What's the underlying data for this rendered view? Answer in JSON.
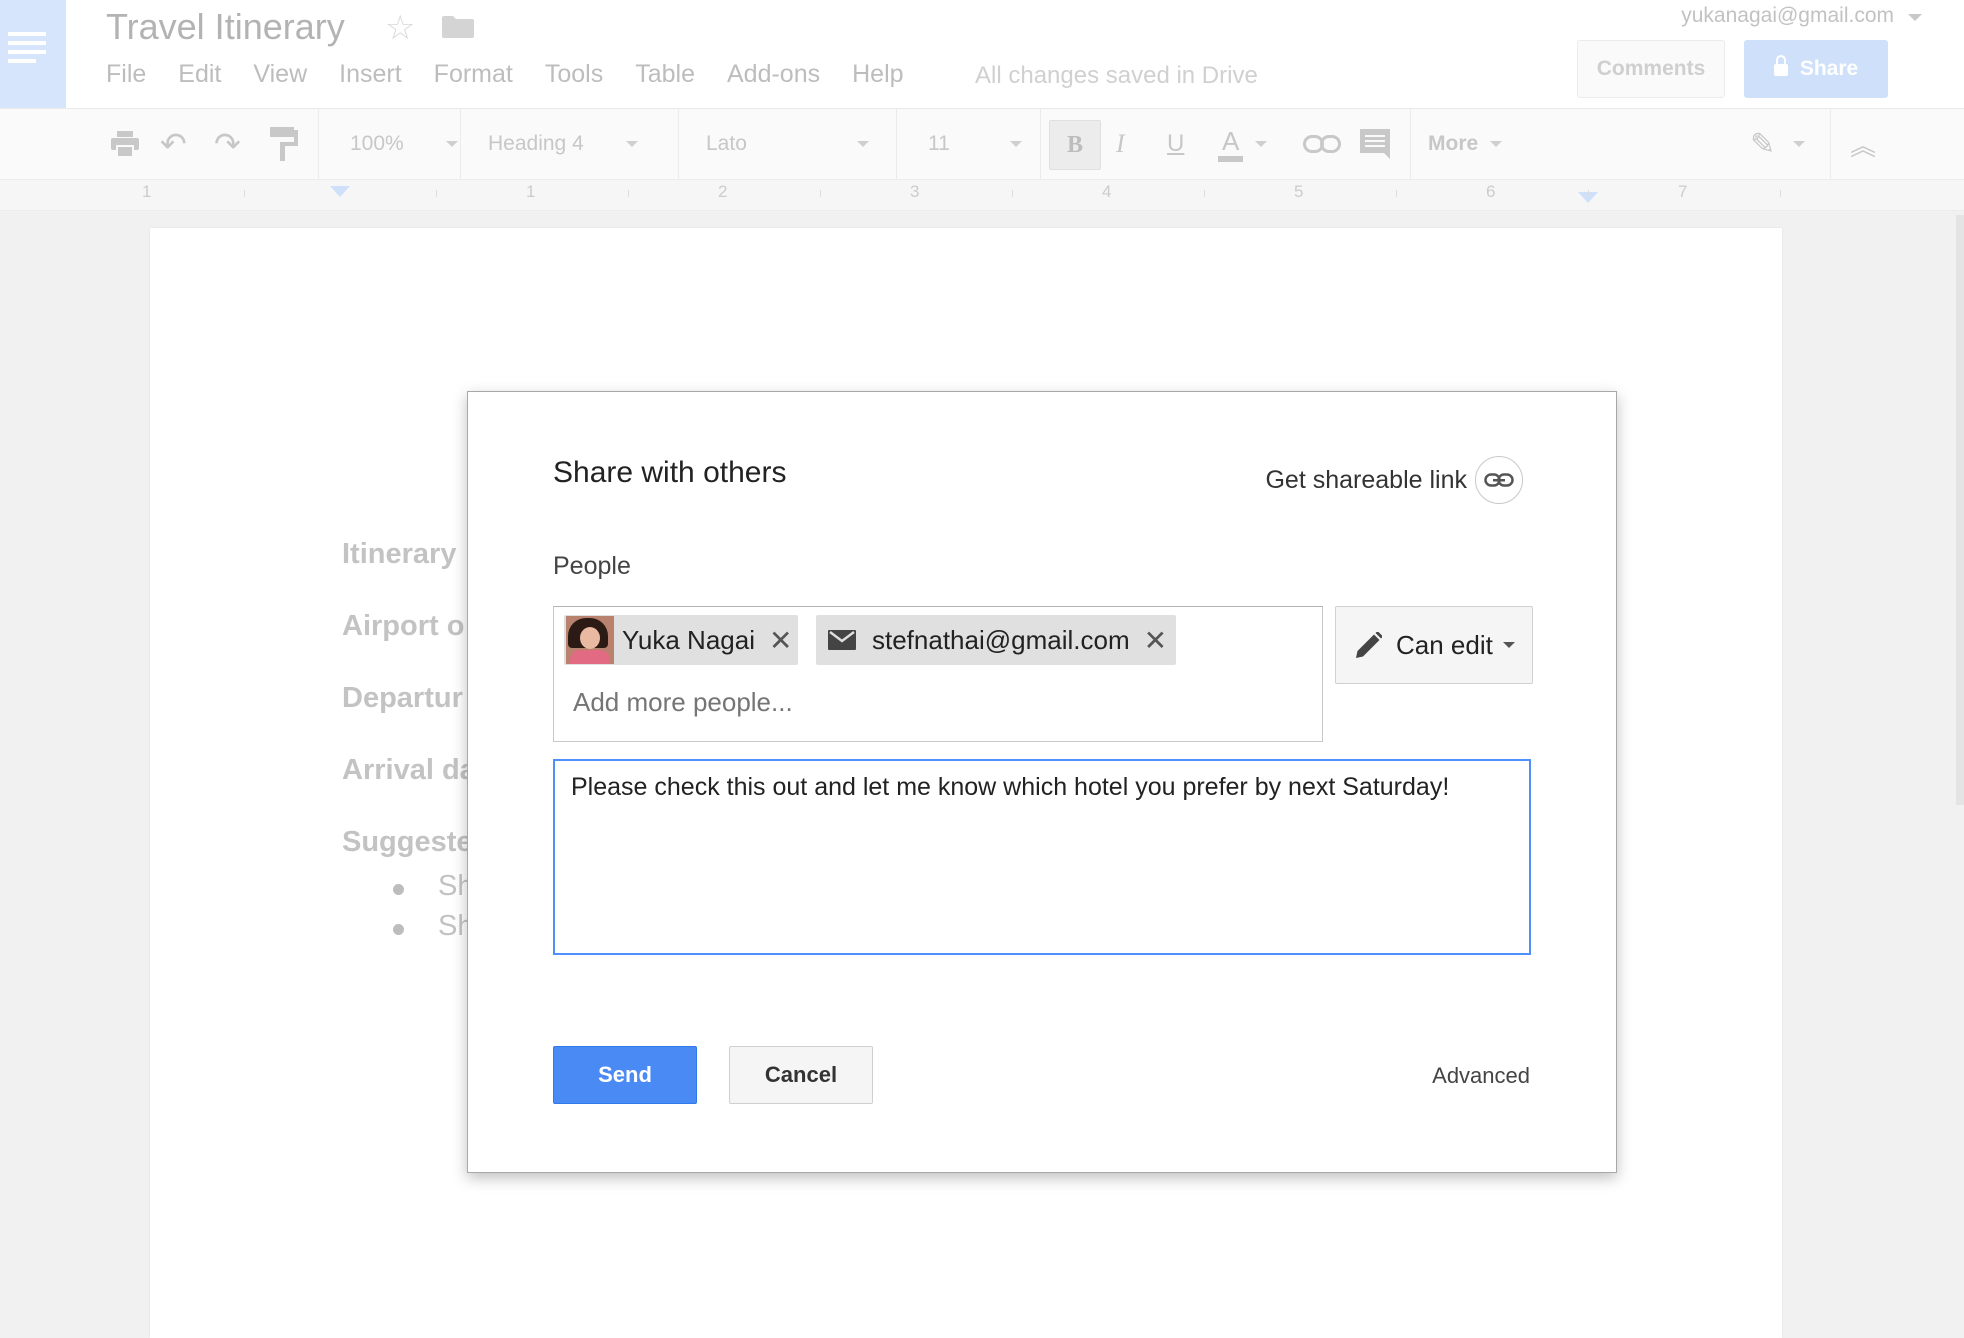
{
  "header": {
    "doc_title": "Travel Itinerary",
    "save_status": "All changes saved in Drive",
    "account": "yukanagai@gmail.com",
    "comments_label": "Comments",
    "share_label": "Share",
    "menu": [
      "File",
      "Edit",
      "View",
      "Insert",
      "Format",
      "Tools",
      "Table",
      "Add-ons",
      "Help"
    ]
  },
  "toolbar": {
    "zoom": "100%",
    "style": "Heading 4",
    "font": "Lato",
    "font_size": "11",
    "bold": "B",
    "italic": "I",
    "underline": "U",
    "text_color": "A",
    "more": "More"
  },
  "ruler": {
    "numbers": [
      "1",
      "1",
      "2",
      "3",
      "4",
      "5",
      "6",
      "7"
    ]
  },
  "document": {
    "lines": [
      "Itinerary",
      "Airport o",
      "Departur",
      "Arrival da",
      "Suggeste"
    ],
    "bullets": [
      "Sh",
      "Sh"
    ]
  },
  "dialog": {
    "title": "Share with others",
    "shareable_link": "Get shareable link",
    "people_label": "People",
    "chips": [
      {
        "name": "Yuka Nagai",
        "type": "contact"
      },
      {
        "name": "stefnathai@gmail.com",
        "type": "email"
      }
    ],
    "add_people_placeholder": "Add more people...",
    "permission": "Can edit",
    "message": "Please check this out and let me know which hotel you prefer by next Saturday!",
    "send_label": "Send",
    "cancel_label": "Cancel",
    "advanced_label": "Advanced"
  },
  "colors": {
    "accent_blue": "#4a8af4",
    "focus_border": "#4d90fe",
    "share_disabled": "#cfe0fb"
  }
}
